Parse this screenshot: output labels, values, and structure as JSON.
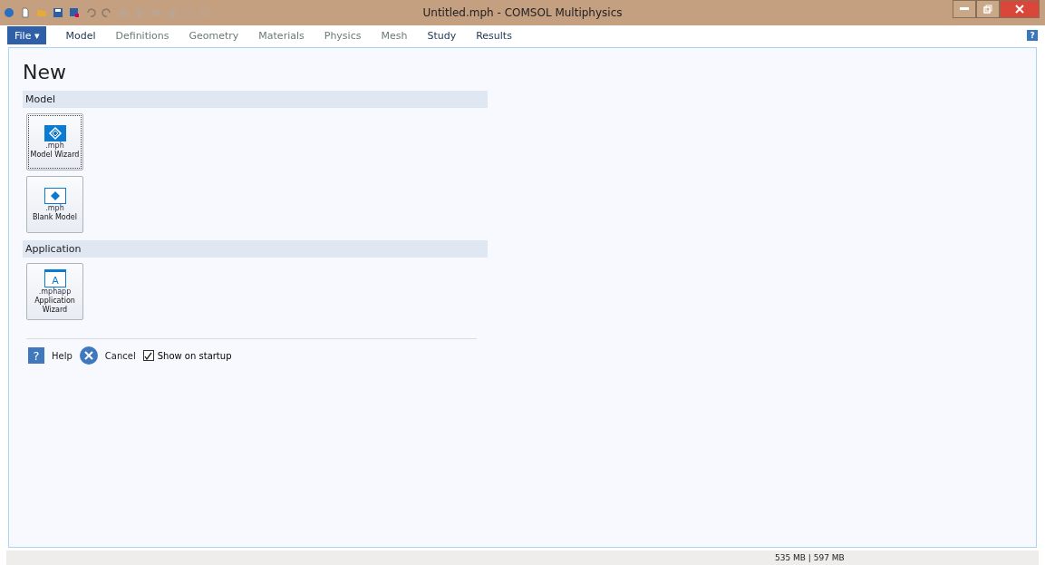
{
  "window": {
    "title": "Untitled.mph - COMSOL Multiphysics"
  },
  "ribbon": {
    "file_menu": "File ▾",
    "help_icon": "?",
    "tabs": [
      {
        "label": "Model",
        "disabled": false
      },
      {
        "label": "Definitions",
        "disabled": true
      },
      {
        "label": "Geometry",
        "disabled": true
      },
      {
        "label": "Materials",
        "disabled": true
      },
      {
        "label": "Physics",
        "disabled": true
      },
      {
        "label": "Mesh",
        "disabled": true
      },
      {
        "label": "Study",
        "disabled": false
      },
      {
        "label": "Results",
        "disabled": false
      }
    ]
  },
  "page": {
    "heading": "New",
    "sections": [
      {
        "title": "Model",
        "tiles": [
          {
            "kind": "wizard",
            "extension": ".mph",
            "label": "Model Wizard",
            "focused": true
          },
          {
            "kind": "blank",
            "extension": ".mph",
            "label": "Blank Model",
            "focused": false
          }
        ]
      },
      {
        "title": "Application",
        "tiles": [
          {
            "kind": "app",
            "glyph": "A",
            "extension": ".mphapp",
            "label": "Application Wizard",
            "focused": false
          }
        ]
      }
    ],
    "footer": {
      "help_glyph": "?",
      "help": "Help",
      "cancel": "Cancel",
      "startup": {
        "label": "Show on startup",
        "checked": true
      }
    }
  },
  "status_bar": {
    "memory": "535 MB | 597 MB"
  }
}
